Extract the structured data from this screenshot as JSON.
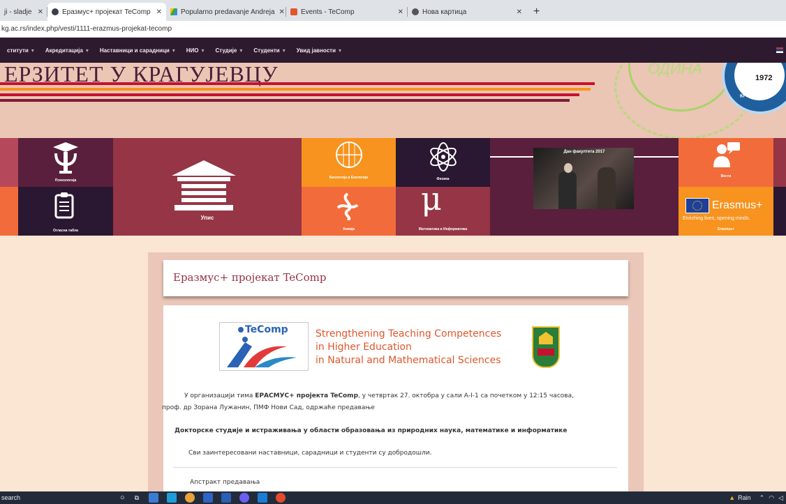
{
  "browser": {
    "tabs": [
      {
        "label": "ji - sladje",
        "active": false,
        "icon": "document-icon"
      },
      {
        "label": "Еразмус+ пројекат TeComp",
        "active": true,
        "icon": "site-icon"
      },
      {
        "label": "Popularno predavanje Andreja",
        "active": false,
        "icon": "drive-icon"
      },
      {
        "label": "Events - TeComp",
        "active": false,
        "icon": "events-icon"
      },
      {
        "label": "Нова картица",
        "active": false,
        "icon": "chrome-icon"
      }
    ],
    "new_tab": "+",
    "url": "kg.ac.rs/index.php/vesti/1111-erazmus-projekat-tecomp"
  },
  "nav": {
    "items": [
      "ститути",
      "Акредитација",
      "Наставници и сарадници",
      "НИО",
      "Студије",
      "Студенти",
      "Увид јавности"
    ]
  },
  "banner": {
    "title": "ЕРЗИТЕТ У КРАГУЈЕВЦУ",
    "godina": "ОДИНА",
    "seal_year": "1972",
    "seal_text": "КРАГУЈЕВАЦ"
  },
  "tiles": {
    "psych": "Психологија",
    "board": "Огласна табла",
    "enroll": "Упис",
    "bio": "Биологија и Екологија",
    "phys": "Физика",
    "chem": "Хемија",
    "math": "Математика и Информатика",
    "day": "Дан факултета 2017",
    "news": "Вести",
    "erasmus": "Erasmus+",
    "erasmus_sub": "Enriching lives, opening minds.",
    "erasmus_small": "Erasmus+"
  },
  "article": {
    "title": "Еразмус+ пројекат TeComp",
    "logo_name": "TeComp",
    "logo_lines": [
      "Strengthening Teaching Competences",
      "in Higher Education",
      "in Natural and Mathematical Sciences"
    ],
    "p1_before": "У организацији тима ",
    "p1_bold": "ЕРАСМУС+ пројекта TeComp",
    "p1_after": ", у четвртак 27. октобра у сали А-I-1 са почетком у 12:15 часова,",
    "p1_line2": "проф. др Зорана Лужанин, ПМФ Нови Сад, одржаће предавање",
    "p2": "Докторске студије и истраживања у области образовања из природних наука, математике и информатике",
    "p3": "Сви заинтересовани наставници, сарадници и студенти су добродошли.",
    "p4": "Апстракт предавања"
  },
  "taskbar": {
    "search": "search",
    "weather": "Rain"
  },
  "colors": {
    "nav_bg": "#2d1a2f",
    "banner_bg": "#ebc6b4",
    "page_bg": "#fbe5d3",
    "accent": "#9a3246",
    "orange": "#f7931e"
  }
}
